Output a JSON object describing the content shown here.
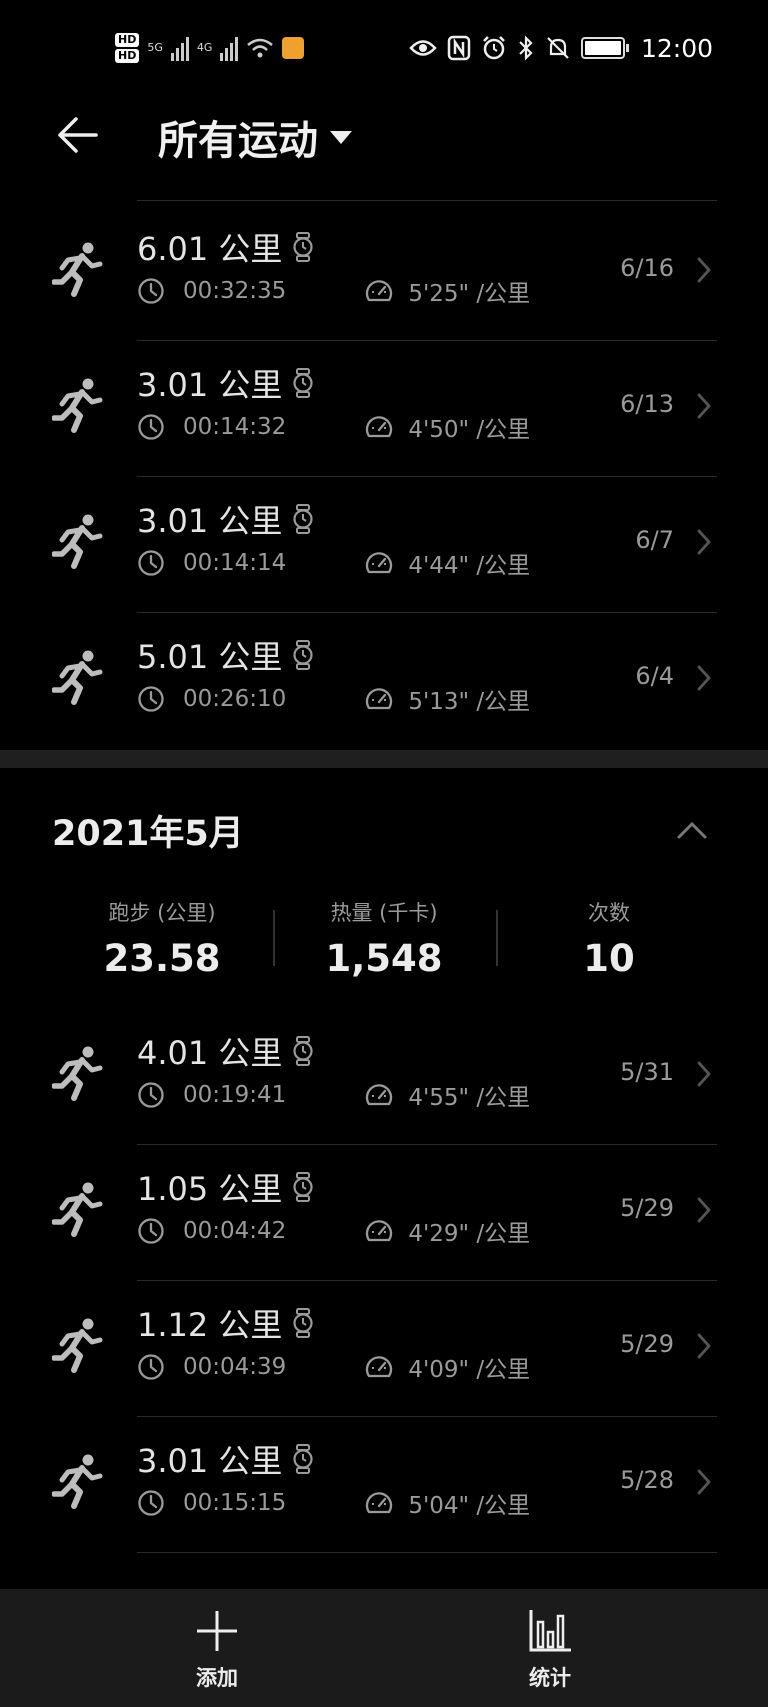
{
  "status_bar": {
    "hd1": "HD",
    "hd2": "HD",
    "net1": "5G",
    "net2": "4G",
    "time": "12:00"
  },
  "header": {
    "title": "所有运动"
  },
  "june_runs": [
    {
      "distance": "6.01 公里",
      "duration": "00:32:35",
      "pace": "5'25\" /公里",
      "date": "6/16"
    },
    {
      "distance": "3.01 公里",
      "duration": "00:14:32",
      "pace": "4'50\" /公里",
      "date": "6/13"
    },
    {
      "distance": "3.01 公里",
      "duration": "00:14:14",
      "pace": "4'44\" /公里",
      "date": "6/7"
    },
    {
      "distance": "5.01 公里",
      "duration": "00:26:10",
      "pace": "5'13\" /公里",
      "date": "6/4"
    }
  ],
  "may_section": {
    "title": "2021年5月",
    "stats": [
      {
        "label": "跑步 (公里)",
        "value": "23.58"
      },
      {
        "label": "热量 (千卡)",
        "value": "1,548"
      },
      {
        "label": "次数",
        "value": "10"
      }
    ]
  },
  "may_runs": [
    {
      "distance": "4.01 公里",
      "duration": "00:19:41",
      "pace": "4'55\" /公里",
      "date": "5/31"
    },
    {
      "distance": "1.05 公里",
      "duration": "00:04:42",
      "pace": "4'29\" /公里",
      "date": "5/29"
    },
    {
      "distance": "1.12 公里",
      "duration": "00:04:39",
      "pace": "4'09\" /公里",
      "date": "5/29"
    },
    {
      "distance": "3.01 公里",
      "duration": "00:15:15",
      "pace": "5'04\" /公里",
      "date": "5/28"
    }
  ],
  "bottom_bar": {
    "add_label": "添加",
    "stats_label": "统计"
  },
  "icons": {
    "back": "arrow-left-icon",
    "dropdown": "triangle-down-icon",
    "runner": "running-person-icon",
    "watch": "watch-icon",
    "clock": "clock-icon",
    "pace": "speedometer-icon",
    "chevron": "chevron-right-icon",
    "collapse": "chevron-up-icon",
    "add": "plus-icon",
    "stats": "bar-chart-icon"
  }
}
